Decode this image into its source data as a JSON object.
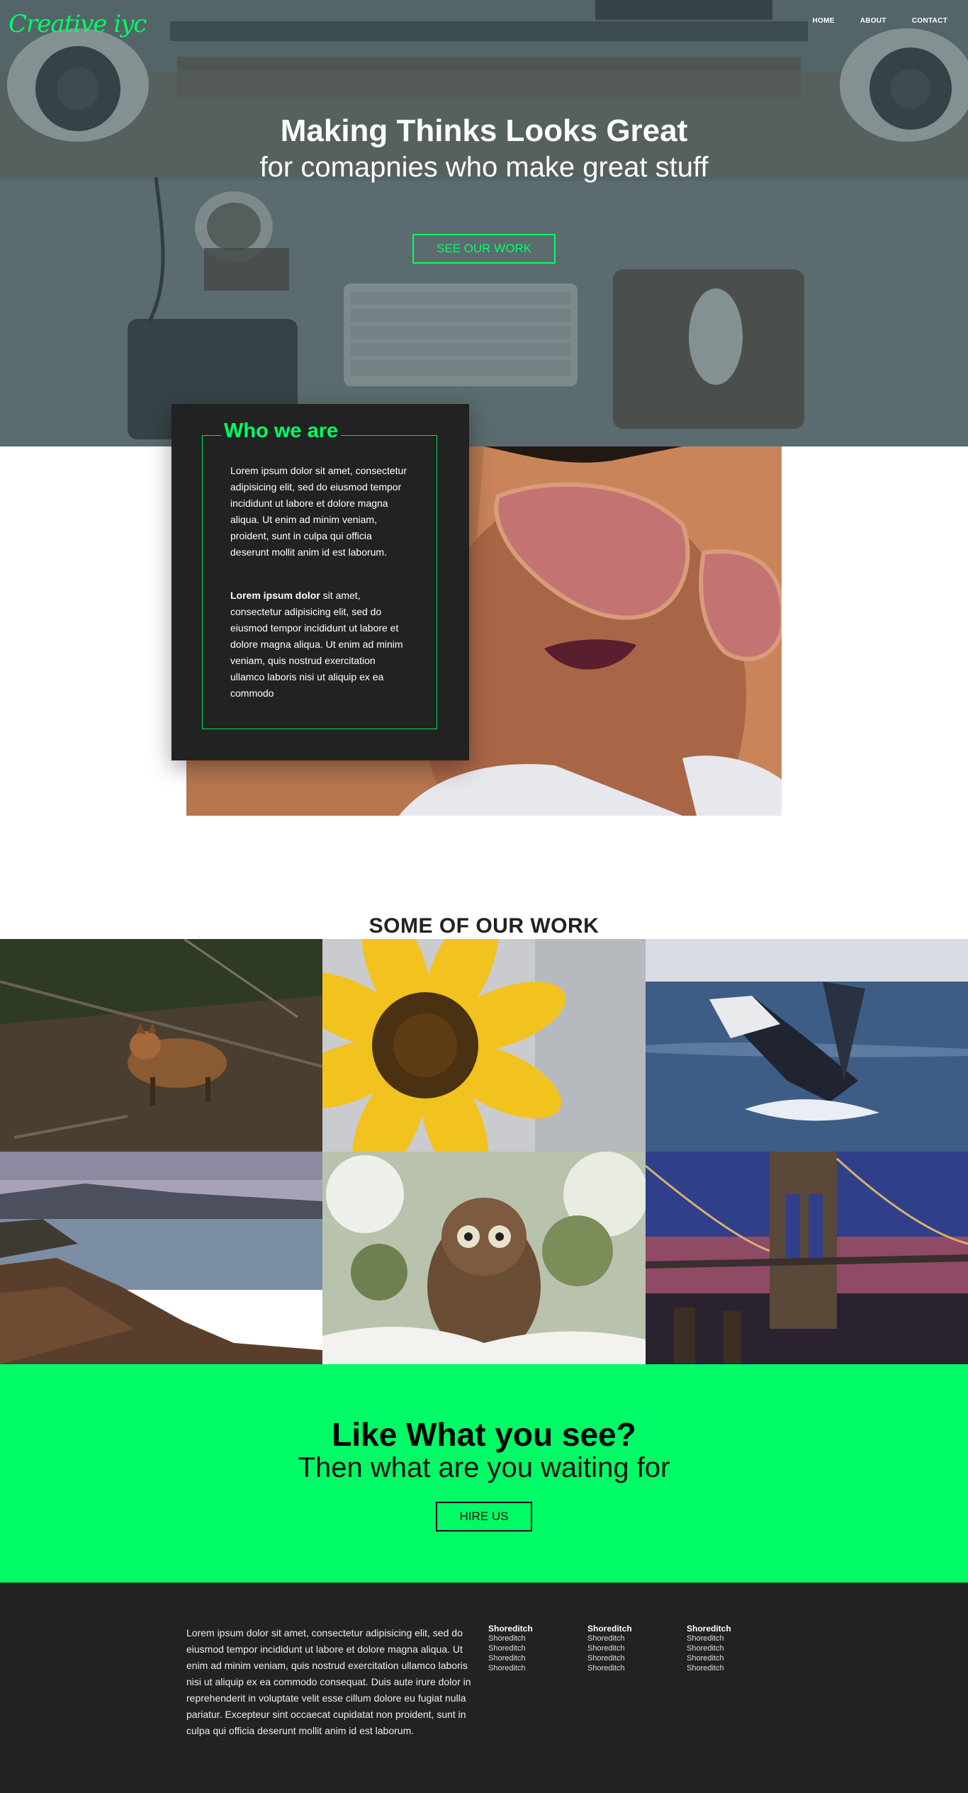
{
  "brand": {
    "logo": "Creative iyc",
    "accent": "#00ff66"
  },
  "nav": {
    "items": [
      "HOME",
      "ABOUT",
      "CONTACT"
    ]
  },
  "hero": {
    "title": "Making Thinks Looks Great",
    "subtitle": "for comapnies who make great stuff",
    "button": "SEE OUR WORK"
  },
  "about": {
    "title": "Who we are",
    "paragraph1": "Lorem ipsum dolor sit amet, consectetur adipisicing elit, sed do eiusmod tempor incididunt ut labore et dolore magna aliqua. Ut enim ad minim veniam, proident, sunt in culpa qui officia deserunt mollit anim id est laborum.",
    "paragraph2_bold": "Lorem ipsum dolor",
    "paragraph2_rest": " sit amet, consectetur adipisicing elit, sed do eiusmod tempor incididunt ut labore et dolore magna aliqua. Ut enim ad minim veniam, quis nostrud exercitation ullamco laboris nisi ut aliquip ex ea commodo"
  },
  "work": {
    "title": "SOME OF OUR WORK",
    "images": [
      "fox-photo",
      "sunflower-photo",
      "whale-photo",
      "beach-photo",
      "owl-photo",
      "bridge-photo"
    ]
  },
  "cta": {
    "title": "Like What you see?",
    "subtitle": "Then what are you waiting for",
    "button": "HIRE US",
    "background": "#00fb66"
  },
  "footer": {
    "text": "Lorem ipsum dolor sit amet, consectetur adipisicing elit, sed do eiusmod tempor incididunt ut labore et dolore magna aliqua. Ut enim ad minim veniam, quis nostrud exercitation ullamco laboris nisi ut aliquip ex ea commodo consequat. Duis aute irure dolor in reprehenderit in voluptate velit esse cillum dolore eu fugiat nulla pariatur. Excepteur sint occaecat cupidatat non proident, sunt in culpa qui officia deserunt mollit anim id est laborum.",
    "columns": [
      {
        "heading": "Shoreditch",
        "links": [
          "Shoreditch",
          "Shoreditch",
          "Shoreditch",
          "Shoreditch"
        ]
      },
      {
        "heading": "Shoreditch",
        "links": [
          "Shoreditch",
          "Shoreditch",
          "Shoreditch",
          "Shoreditch"
        ]
      },
      {
        "heading": "Shoreditch",
        "links": [
          "Shoreditch",
          "Shoreditch",
          "Shoreditch",
          "Shoreditch"
        ]
      }
    ],
    "background": "#222222"
  }
}
